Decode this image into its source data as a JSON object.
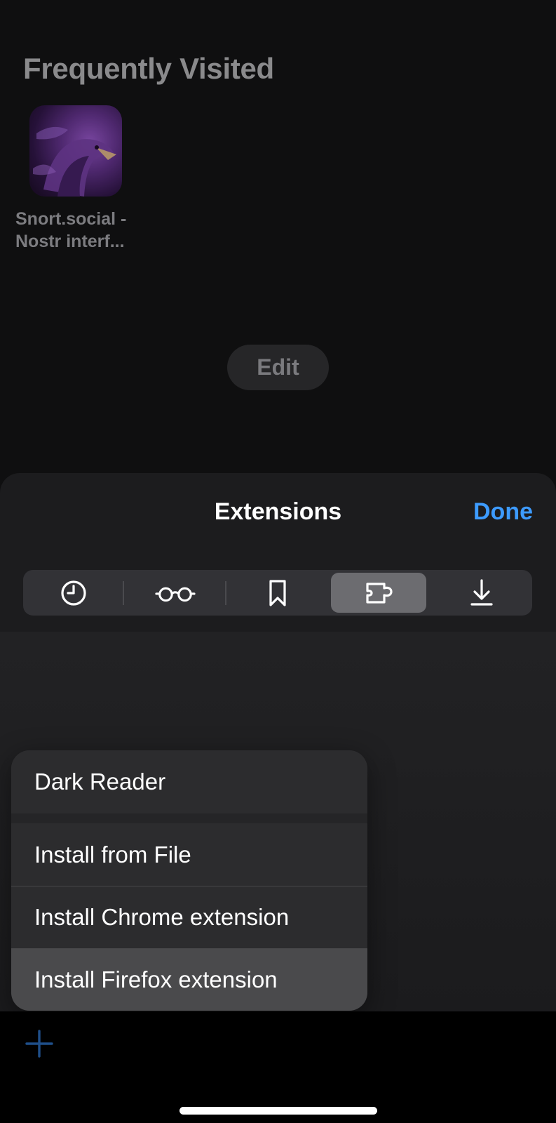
{
  "background": {
    "section_title": "Frequently Visited",
    "tile": {
      "caption": "Snort.social - Nostr interf..."
    },
    "edit_label": "Edit"
  },
  "sheet": {
    "title": "Extensions",
    "done_label": "Done",
    "segments": [
      {
        "icon": "clock-icon",
        "selected": false
      },
      {
        "icon": "glasses-icon",
        "selected": false
      },
      {
        "icon": "bookmark-icon",
        "selected": false
      },
      {
        "icon": "puzzle-icon",
        "selected": true
      },
      {
        "icon": "download-icon",
        "selected": false
      }
    ]
  },
  "menu": {
    "items": [
      {
        "label": "Dark Reader"
      },
      {
        "label": "Install from File"
      },
      {
        "label": "Install Chrome extension"
      },
      {
        "label": "Install Firefox extension"
      }
    ]
  },
  "bottom_bar": {
    "add_icon": "plus-icon"
  },
  "colors": {
    "accent": "#3d9bff",
    "sheet_bg": "#1c1c1e",
    "menu_bg": "#2c2c2e",
    "menu_highlight": "#4a4a4c"
  }
}
